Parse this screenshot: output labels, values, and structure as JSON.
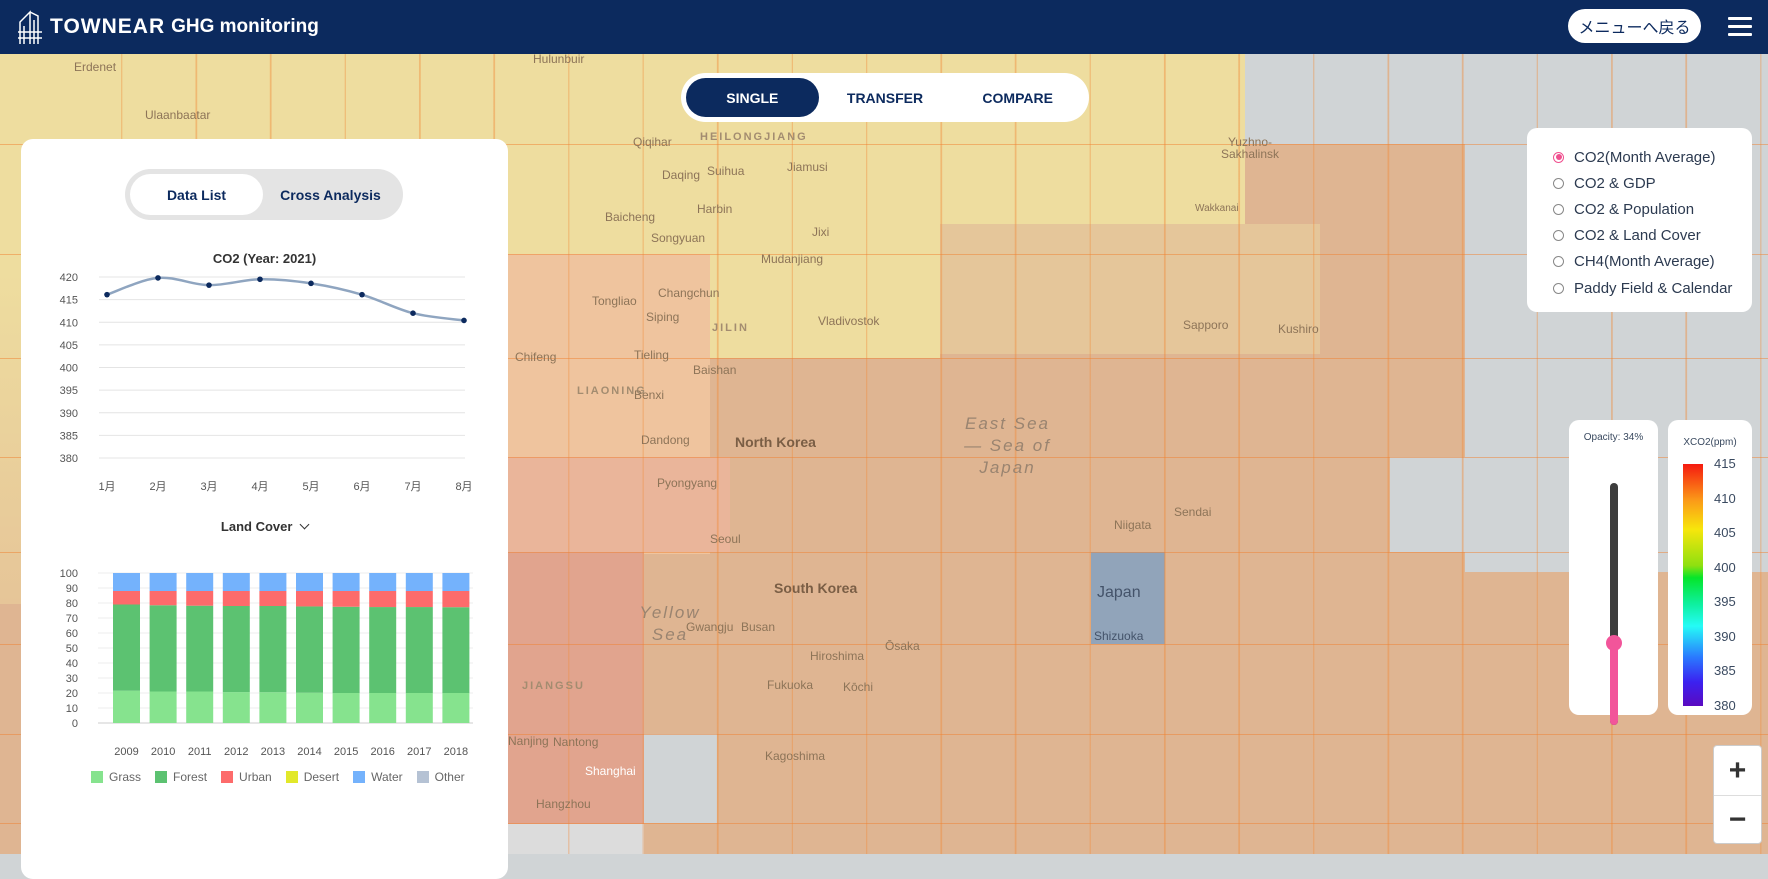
{
  "header": {
    "brand": "TOWNEAR",
    "subtitle": "GHG monitoring",
    "menu_back": "メニューへ戻る"
  },
  "modes": [
    "SINGLE",
    "TRANSFER",
    "COMPARE"
  ],
  "panel": {
    "tabs": [
      "Data List",
      "Cross Analysis"
    ],
    "landcover_title": "Land Cover"
  },
  "layers": [
    {
      "label": "CO2(Month Average)",
      "selected": true
    },
    {
      "label": "CO2 & GDP",
      "selected": false
    },
    {
      "label": "CO2 & Population",
      "selected": false
    },
    {
      "label": "CO2 & Land Cover",
      "selected": false
    },
    {
      "label": "CH4(Month Average)",
      "selected": false
    },
    {
      "label": "Paddy Field & Calendar",
      "selected": false
    }
  ],
  "opacity": {
    "label": "Opacity: 34%",
    "value": 34
  },
  "scale": {
    "title": "XCO2(ppm)",
    "ticks": [
      "415",
      "410",
      "405",
      "400",
      "395",
      "390",
      "385",
      "380"
    ]
  },
  "zoom": {
    "in": "+",
    "out": "−"
  },
  "map": {
    "labels": [
      "Erdenet",
      "Ulaanbaatar",
      "Hulunbuir",
      "Qiqihar",
      "HEILONGJIANG",
      "Daqing",
      "Suihua",
      "Jiamusi",
      "Baicheng",
      "Harbin",
      "Songyuan",
      "Jixi",
      "Mudanjiang",
      "Tongliao",
      "Changchun",
      "Siping",
      "JILIN",
      "Vladivostok",
      "Chifeng",
      "Tieling",
      "Baishan",
      "LIAONING",
      "Benxi",
      "Dandong",
      "North Korea",
      "East Sea — Sea of Japan",
      "Pyongyang",
      "Seoul",
      "South Korea",
      "Yellow Sea",
      "Gwangju",
      "Busan",
      "Hiroshima",
      "Ōsaka",
      "Japan",
      "Shizuoka",
      "Niigata",
      "Sendai",
      "Fukuoka",
      "Kōchi",
      "Kagoshima",
      "JIANGSU",
      "Nanjing",
      "Nantong",
      "Shanghai",
      "Hangzhou",
      "Sapporo",
      "Kushiro",
      "Wakkanai",
      "Yuzhno-Sakhalinsk"
    ]
  },
  "chart_data": [
    {
      "type": "line",
      "title": "CO2 (Year: 2021)",
      "categories": [
        "1月",
        "2月",
        "3月",
        "4月",
        "5月",
        "6月",
        "7月",
        "8月"
      ],
      "values": [
        416.1,
        419.8,
        418.2,
        419.5,
        418.6,
        416.1,
        412.0,
        410.4
      ],
      "ylim": [
        380,
        420
      ],
      "yticks": [
        "420",
        "415",
        "410",
        "405",
        "400",
        "395",
        "390",
        "385",
        "380"
      ],
      "color": "#8fa5c0",
      "point_color": "#0c2a5e"
    },
    {
      "type": "bar",
      "stacked": true,
      "title": "Land Cover",
      "categories": [
        "2009",
        "2010",
        "2011",
        "2012",
        "2013",
        "2014",
        "2015",
        "2016",
        "2017",
        "2018"
      ],
      "ylim": [
        0,
        100
      ],
      "yticks": [
        "100",
        "90",
        "80",
        "70",
        "60",
        "50",
        "40",
        "30",
        "20",
        "10",
        "0"
      ],
      "legend_position": "bottom",
      "series": [
        {
          "name": "Grass",
          "color": "#86e38e",
          "values": [
            21.5,
            21,
            21,
            20.6,
            20.5,
            20.2,
            20,
            20,
            20,
            20
          ]
        },
        {
          "name": "Forest",
          "color": "#5cc271",
          "values": [
            57.5,
            57.5,
            57.2,
            57.4,
            57.5,
            57.5,
            57.5,
            57.3,
            57.3,
            57.2
          ]
        },
        {
          "name": "Urban",
          "color": "#fd6b6b",
          "values": [
            9,
            9.5,
            9.8,
            10,
            10,
            10.3,
            10.5,
            10.7,
            10.7,
            10.8
          ]
        },
        {
          "name": "Desert",
          "color": "#e2e82a",
          "values": [
            0,
            0,
            0,
            0,
            0,
            0,
            0,
            0,
            0,
            0
          ]
        },
        {
          "name": "Water",
          "color": "#74b2fc",
          "values": [
            12,
            12,
            12,
            12,
            12,
            12,
            12,
            12,
            12,
            12
          ]
        },
        {
          "name": "Other",
          "color": "#b5c2d4",
          "values": [
            0,
            0,
            0,
            0,
            0,
            0,
            0,
            0,
            0,
            0
          ]
        }
      ]
    }
  ]
}
